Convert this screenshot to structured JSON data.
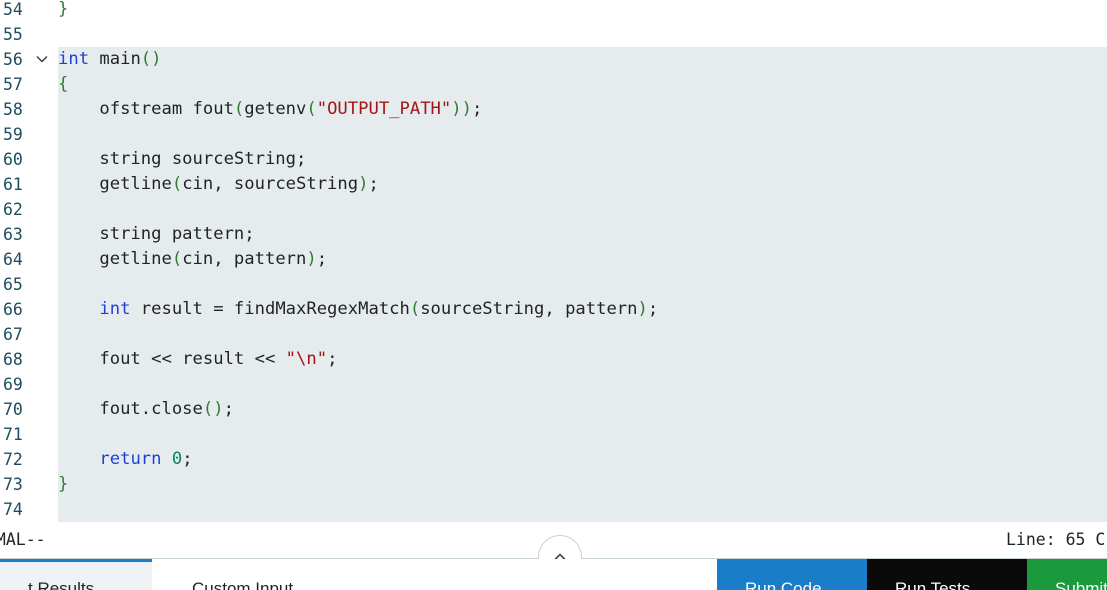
{
  "editor": {
    "lines": [
      {
        "num": "54",
        "tokens": [
          {
            "t": "}",
            "c": "br"
          }
        ]
      },
      {
        "num": "55",
        "tokens": []
      },
      {
        "num": "56",
        "fold": true,
        "tokens": [
          {
            "t": "int",
            "c": "kw"
          },
          {
            "t": " main",
            "c": ""
          },
          {
            "t": "()",
            "c": "pn"
          }
        ]
      },
      {
        "num": "57",
        "tokens": [
          {
            "t": "{",
            "c": "br"
          }
        ]
      },
      {
        "num": "58",
        "tokens": [
          {
            "t": "    ofstream fout",
            "c": ""
          },
          {
            "t": "(",
            "c": "pn"
          },
          {
            "t": "getenv",
            "c": ""
          },
          {
            "t": "(",
            "c": "pn"
          },
          {
            "t": "\"OUTPUT_PATH\"",
            "c": "str"
          },
          {
            "t": "))",
            "c": "pn"
          },
          {
            "t": ";",
            "c": ""
          }
        ]
      },
      {
        "num": "59",
        "tokens": []
      },
      {
        "num": "60",
        "tokens": [
          {
            "t": "    string sourceString;",
            "c": ""
          }
        ]
      },
      {
        "num": "61",
        "tokens": [
          {
            "t": "    getline",
            "c": ""
          },
          {
            "t": "(",
            "c": "pn"
          },
          {
            "t": "cin, sourceString",
            "c": ""
          },
          {
            "t": ")",
            "c": "pn"
          },
          {
            "t": ";",
            "c": ""
          }
        ]
      },
      {
        "num": "62",
        "tokens": []
      },
      {
        "num": "63",
        "tokens": [
          {
            "t": "    string pattern;",
            "c": ""
          }
        ]
      },
      {
        "num": "64",
        "tokens": [
          {
            "t": "    getline",
            "c": ""
          },
          {
            "t": "(",
            "c": "pn"
          },
          {
            "t": "cin, pattern",
            "c": ""
          },
          {
            "t": ")",
            "c": "pn"
          },
          {
            "t": ";",
            "c": ""
          }
        ]
      },
      {
        "num": "65",
        "tokens": []
      },
      {
        "num": "66",
        "tokens": [
          {
            "t": "    ",
            "c": ""
          },
          {
            "t": "int",
            "c": "kw"
          },
          {
            "t": " result = findMaxRegexMatch",
            "c": ""
          },
          {
            "t": "(",
            "c": "pn"
          },
          {
            "t": "sourceString, pattern",
            "c": ""
          },
          {
            "t": ")",
            "c": "pn"
          },
          {
            "t": ";",
            "c": ""
          }
        ]
      },
      {
        "num": "67",
        "tokens": []
      },
      {
        "num": "68",
        "tokens": [
          {
            "t": "    fout << result << ",
            "c": ""
          },
          {
            "t": "\"\\n\"",
            "c": "str"
          },
          {
            "t": ";",
            "c": ""
          }
        ]
      },
      {
        "num": "69",
        "tokens": []
      },
      {
        "num": "70",
        "tokens": [
          {
            "t": "    fout.close",
            "c": ""
          },
          {
            "t": "()",
            "c": "pn"
          },
          {
            "t": ";",
            "c": ""
          }
        ]
      },
      {
        "num": "71",
        "tokens": []
      },
      {
        "num": "72",
        "tokens": [
          {
            "t": "    ",
            "c": ""
          },
          {
            "t": "return",
            "c": "kw"
          },
          {
            "t": " ",
            "c": ""
          },
          {
            "t": "0",
            "c": "num"
          },
          {
            "t": ";",
            "c": ""
          }
        ]
      },
      {
        "num": "73",
        "tokens": [
          {
            "t": "}",
            "c": "br"
          }
        ]
      },
      {
        "num": "74",
        "tokens": []
      }
    ]
  },
  "status": {
    "mode": "RMAL--",
    "line_info": "Line: 65 C"
  },
  "icons": {
    "fold": "chevron-down-icon",
    "collapse": "chevron-up-icon"
  },
  "bottom_tabs": {
    "results": "t Results",
    "custom_input": "Custom Input",
    "run": "Run Code",
    "test": "Run Tests",
    "submit": "Submit"
  },
  "colors": {
    "accent_blue": "#1a7dc7",
    "submit_green": "#1a9a3c",
    "run_tests_black": "#0a0a0a",
    "highlight_bg": "#e6ebee"
  }
}
